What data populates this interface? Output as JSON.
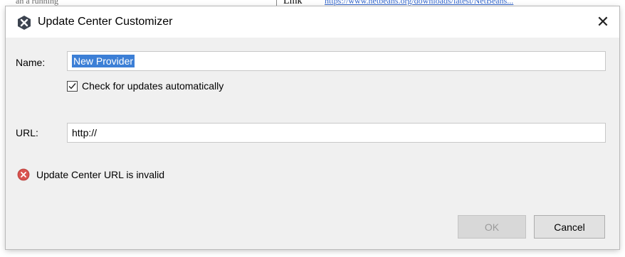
{
  "background": {
    "left_text": "an a running",
    "word": "Link",
    "link_text": "https://www.netbeans.org/downloads/latest/NetBeans..."
  },
  "dialog": {
    "title": "Update Center Customizer",
    "close_glyph": "✕"
  },
  "form": {
    "name_label": "Name:",
    "name_value": "New Provider",
    "check_label": "Check for updates automatically",
    "check_checked": true,
    "url_label": "URL:",
    "url_value": "http://"
  },
  "status": {
    "error_text": "Update Center URL is invalid",
    "error_color": "#d9534f"
  },
  "buttons": {
    "ok_label": "OK",
    "ok_enabled": false,
    "cancel_label": "Cancel"
  },
  "icons": {
    "app": "netbeans-icon",
    "close": "close-icon",
    "check": "checkmark-icon",
    "error": "error-icon"
  }
}
